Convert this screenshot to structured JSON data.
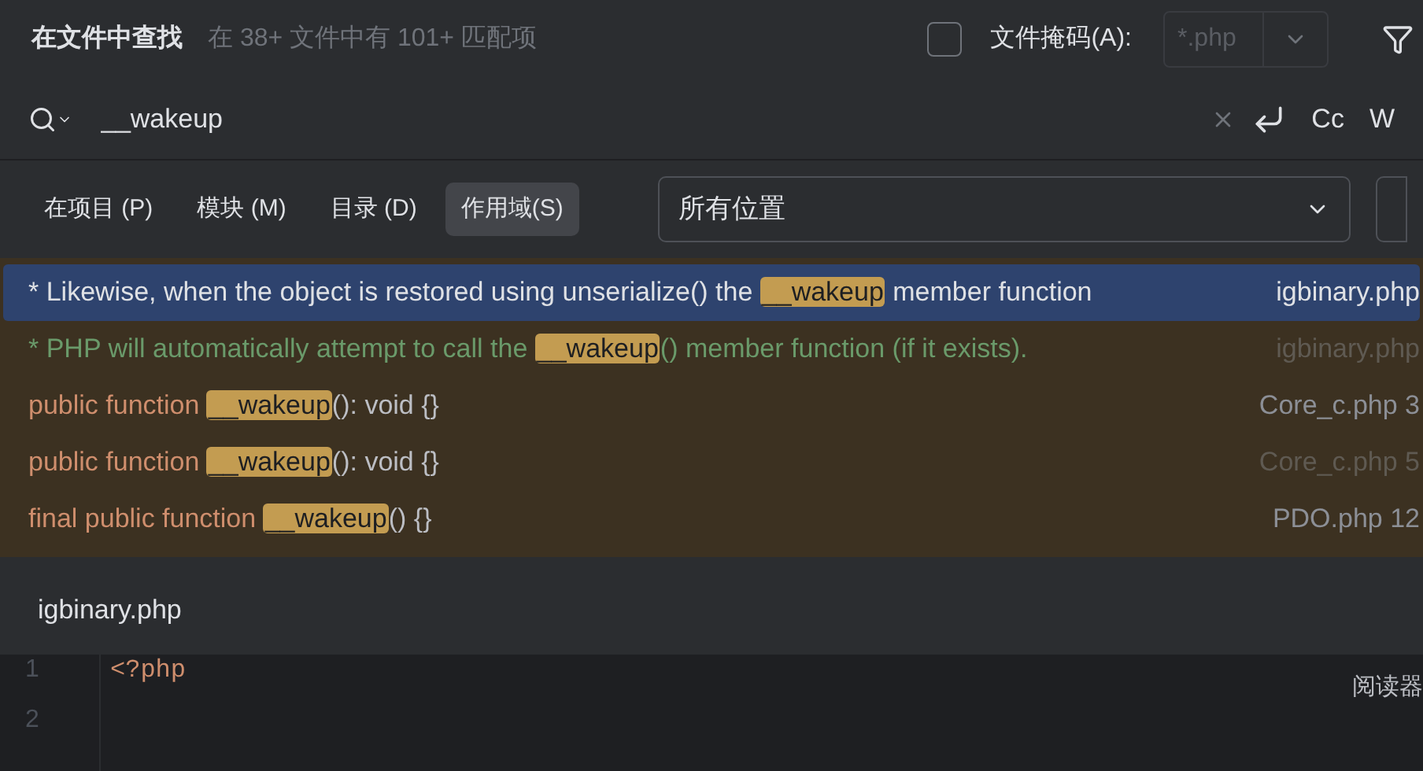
{
  "header": {
    "title": "在文件中查找",
    "summary": "在 38+ 文件中有 101+ 匹配项",
    "file_mask": {
      "checked": false,
      "label": "文件掩码(A):",
      "placeholder": "*.php"
    }
  },
  "search": {
    "value": "__wakeup",
    "toggles": [
      "Cc",
      "W"
    ]
  },
  "scopes": [
    {
      "label": "在项目 (P)",
      "selected": false
    },
    {
      "label": "模块 (M)",
      "selected": false
    },
    {
      "label": "目录 (D)",
      "selected": false
    },
    {
      "label": "作用域(S)",
      "selected": true
    }
  ],
  "scope_select": {
    "value": "所有位置"
  },
  "results": [
    {
      "selected": true,
      "dim": false,
      "file": "igbinary.php",
      "segments": [
        {
          "kind": "comment",
          "text": "* Likewise, when the object is restored using unserialize() the "
        },
        {
          "kind": "match",
          "text": "__wakeup"
        },
        {
          "kind": "comment",
          "text": " member function"
        }
      ]
    },
    {
      "selected": false,
      "dim": true,
      "file": "igbinary.php",
      "segments": [
        {
          "kind": "comment",
          "text": "* PHP will automatically attempt to call the "
        },
        {
          "kind": "match",
          "text": "__wakeup"
        },
        {
          "kind": "comment",
          "text": "() member function (if it exists)."
        }
      ]
    },
    {
      "selected": false,
      "dim": false,
      "file": "Core_c.php 3",
      "segments": [
        {
          "kind": "keyword",
          "text": "public function "
        },
        {
          "kind": "match",
          "text": "__wakeup"
        },
        {
          "kind": "plain",
          "text": "(): void {}"
        }
      ]
    },
    {
      "selected": false,
      "dim": true,
      "file": "Core_c.php 5",
      "segments": [
        {
          "kind": "keyword",
          "text": "public function "
        },
        {
          "kind": "match",
          "text": "__wakeup"
        },
        {
          "kind": "plain",
          "text": "(): void {}"
        }
      ]
    },
    {
      "selected": false,
      "dim": false,
      "file": "PDO.php 12",
      "segments": [
        {
          "kind": "keyword",
          "text": "final public function "
        },
        {
          "kind": "match",
          "text": "__wakeup"
        },
        {
          "kind": "plain",
          "text": "() {}"
        }
      ]
    }
  ],
  "preview": {
    "file": "igbinary.php",
    "lines": [
      {
        "number": "1",
        "code": "<?php"
      },
      {
        "number": "2"
      }
    ],
    "reader_mode": "阅读器"
  }
}
